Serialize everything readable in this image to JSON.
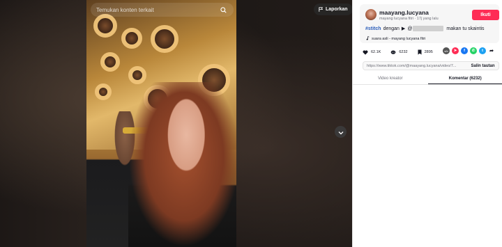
{
  "video": {
    "search_placeholder": "Temukan konten terkait",
    "report_label": "Laporkan"
  },
  "post": {
    "username": "maayang.lucyana",
    "subline": "mayang lucyana fitri · 17j yang lalu",
    "follow_label": "Ikuti",
    "hashtag": "#stitch",
    "caption_prefix": "dengan",
    "caption_play": "▶",
    "caption_mention": "@",
    "caption_suffix": "makan tu skaintis",
    "music": "suara asli - mayang lucyana fitri"
  },
  "stats": {
    "likes": "62.1K",
    "comments": "6232",
    "saves": "2895"
  },
  "share_buttons": [
    {
      "name": "embed",
      "glyph": "</>",
      "color": "#555555"
    },
    {
      "name": "send",
      "glyph": "➤",
      "color": "#fe2c55"
    },
    {
      "name": "facebook",
      "glyph": "f",
      "color": "#1877f2"
    },
    {
      "name": "whatsapp",
      "glyph": "✆",
      "color": "#25d366"
    },
    {
      "name": "twitter",
      "glyph": "t",
      "color": "#1da1f2"
    },
    {
      "name": "more",
      "glyph": "➦",
      "color": "#161823"
    }
  ],
  "link": {
    "url": "https://www.tiktok.com/@maayang.lucyana/video/7...",
    "copy_label": "Salin tautan"
  },
  "tabs": [
    {
      "label": "Video kreator",
      "active": false
    },
    {
      "label": "Komentar (6232)",
      "active": true
    }
  ],
  "colors": {
    "accent": "#fe2c55",
    "hashtag": "#2b5db9"
  }
}
